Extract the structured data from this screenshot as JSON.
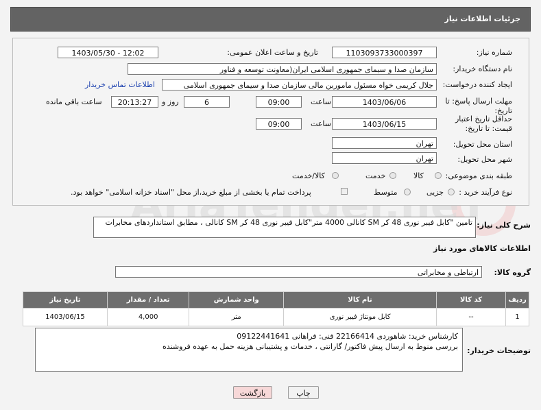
{
  "header": {
    "title": "جزئیات اطلاعات نیاز"
  },
  "form": {
    "need_number_label": "شماره نیاز:",
    "need_number": "1103093733000397",
    "announce_label": "تاریخ و ساعت اعلان عمومی:",
    "announce_value": "1403/05/30 - 12:02",
    "buyer_org_label": "نام دستگاه خریدار:",
    "buyer_org": "سازمان صدا و سیمای جمهوری اسلامی ایران(معاونت توسعه و فناور",
    "requester_label": "ایجاد کننده درخواست:",
    "requester": "جلال کریمی خواه مسئول ماموربن مالی  سازمان صدا و سیمای جمهوری اسلامی",
    "buyer_contact_link": "اطلاعات تماس خریدار",
    "deadline_label": "مهلت ارسال پاسخ: تا تاریخ:",
    "deadline_date": "1403/06/06",
    "time_word": "ساعت",
    "deadline_time": "09:00",
    "days_value": "6",
    "days_word": "روز و",
    "remaining_time": "20:13:27",
    "remaining_word": "ساعت باقی مانده",
    "validity_label": "حداقل تاریخ اعتبار قیمت: تا تاریخ:",
    "validity_date": "1403/06/15",
    "validity_time": "09:00",
    "province_label": "استان محل تحویل:",
    "province": "تهران",
    "city_label": "شهر محل تحویل:",
    "city": "تهران",
    "category_label": "طبقه بندی موضوعی:",
    "category_options": [
      "کالا",
      "خدمت",
      "کالا/خدمت"
    ],
    "process_label": "نوع فرآیند خرید :",
    "process_options": [
      "جزیی",
      "متوسط"
    ],
    "payment_note": "پرداخت تمام یا بخشی از مبلغ خرید،از محل \"اسناد خزانه اسلامی\" خواهد بود."
  },
  "description": {
    "label": "شرح کلی نیاز:",
    "text": "تامین \"کابل فیبر نوری 48 کر SM کانالی 4000 متر\"کابل فیبر نوری 48 کر SM کانالی ، مطابق استانداردهای مخابرات"
  },
  "goods_info": {
    "title": "اطلاعات کالاهای مورد نیاز",
    "group_label": "گروه کالا:",
    "group_value": "ارتباطی و مخابراتی"
  },
  "items_table": {
    "headers": [
      "ردیف",
      "کد کالا",
      "نام کالا",
      "واحد شمارش",
      "تعداد / مقدار",
      "تاریخ نیاز"
    ],
    "rows": [
      [
        "1",
        "--",
        "کابل مونتاژ فیبر نوری",
        "متر",
        "4,000",
        "1403/06/15"
      ]
    ]
  },
  "buyer_notes": {
    "label": "توضیحات خریدار:",
    "line1": "کارشناس خرید: شاهوردی 22166414 فنی: فراهانی 09122441641",
    "line2": "بررسی منوط به ارسال پیش فاکتور/ گارانتی ، خدمات و پشتیبانی هزینه حمل به عهده فروشنده"
  },
  "buttons": {
    "print": "چاپ",
    "back": "بازگشت"
  },
  "watermark": {
    "text": "AriaTender.neT"
  },
  "colors": {
    "header_bg": "#636363",
    "link": "#1a3fae",
    "table_header": "#6e6e6e",
    "back_button_bg": "#f7d8d8"
  }
}
